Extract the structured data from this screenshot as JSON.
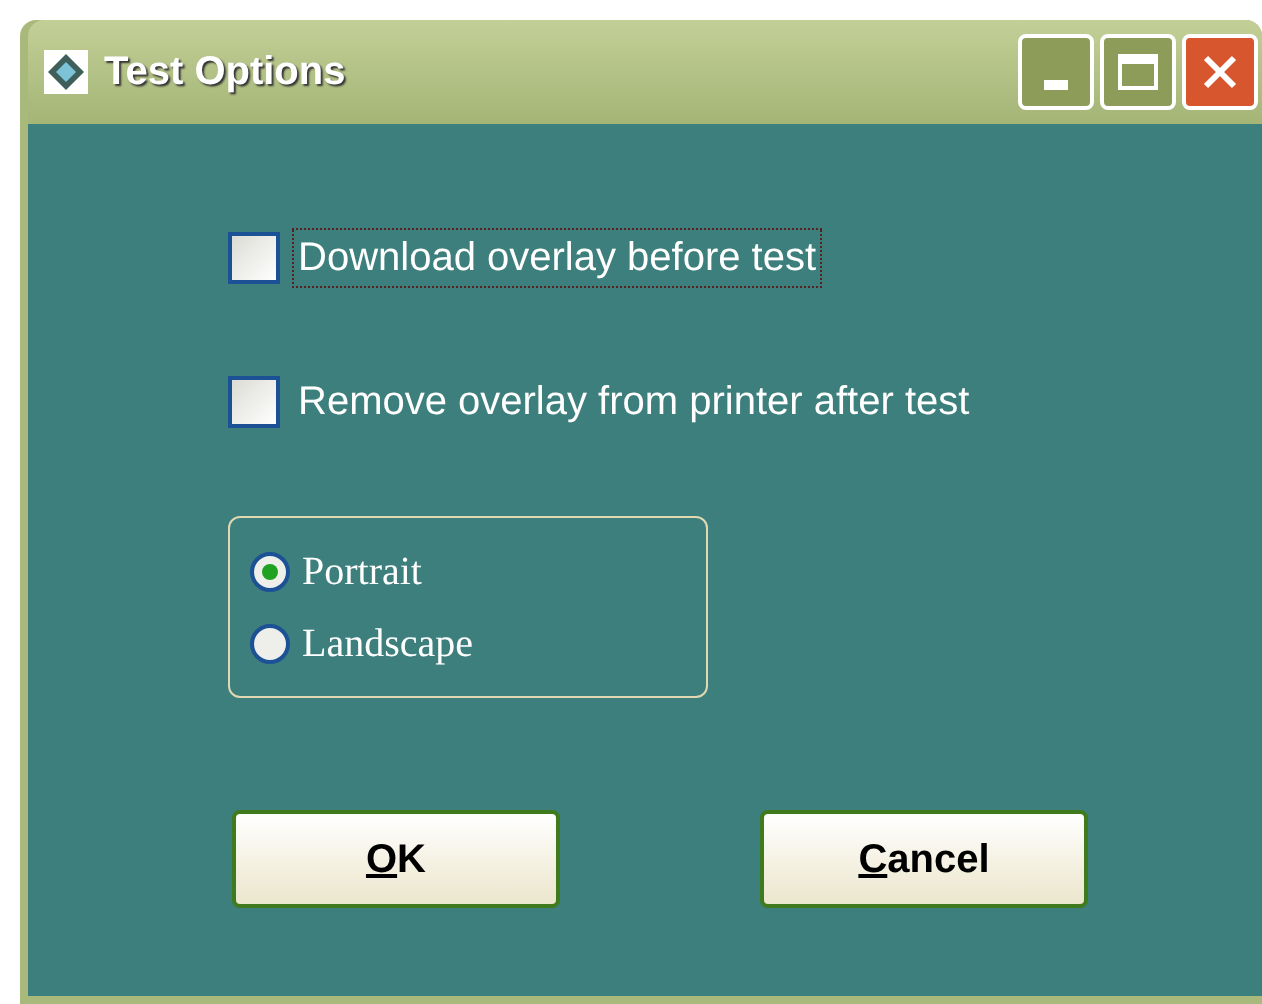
{
  "window": {
    "title": "Test Options"
  },
  "checkboxes": [
    {
      "label": "Download overlay before test",
      "checked": false,
      "focused": true
    },
    {
      "label": "Remove overlay from printer after test",
      "checked": false,
      "focused": false
    }
  ],
  "orientation": [
    {
      "label": "Portrait",
      "selected": true
    },
    {
      "label": "Landscape",
      "selected": false
    }
  ],
  "buttons": [
    {
      "mnemonic": "O",
      "rest": "K"
    },
    {
      "mnemonic": "C",
      "rest": "ancel"
    }
  ]
}
